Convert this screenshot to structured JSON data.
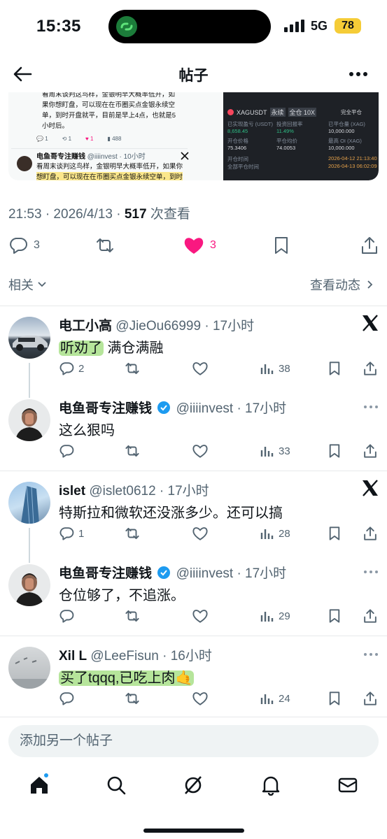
{
  "status": {
    "time": "15:35",
    "network": "5G",
    "battery": "78"
  },
  "header": {
    "title": "帖子"
  },
  "media": {
    "left_text_top": [
      "看周末谈判这鸟样，金银明早大概率低开，如",
      "果你想盯盘，可以现在在币圈买点金银永续空",
      "单，到时开盘就平，目前是早上4点，也就是5",
      "小时后。"
    ],
    "left_stats": [
      "1",
      "1",
      "1",
      "488"
    ],
    "quote_name": "电鱼哥专注赚钱",
    "quote_handle": "@iiiinvest · 10小时",
    "quote_text": [
      "看周末谈判这鸟样，金银明早大概率低开，如果你",
      "想盯盘，可以现在在币圈买点金银永续空单，到时"
    ],
    "right_symbol": "XAGUSDT",
    "right_tags": [
      "永续",
      "全仓 10X"
    ],
    "right_margin_label": "完全平仓",
    "right_rows": [
      [
        "已实现盈亏 (USDT)",
        "投资回报率",
        "已平仓量 (XAG)"
      ],
      [
        "8,658.45",
        "11.49%",
        "10,000.000"
      ],
      [
        "开仓价格",
        "平仓均价",
        "最高 OI (XAG)"
      ],
      [
        "75.3406",
        "74.0053",
        "10,000.000"
      ],
      [
        "开仓时间",
        "",
        "2026-04-12 21:13:40"
      ],
      [
        "全部平仓时间",
        "",
        "2026-04-13 06:02:09"
      ]
    ]
  },
  "post_meta": {
    "time": "21:53 · 2026/4/13 · ",
    "views": "517",
    "views_label": " 次查看"
  },
  "post_actions": {
    "replies": "3",
    "likes": "3"
  },
  "related": {
    "label": "相关",
    "activity": "查看动态"
  },
  "replies": [
    {
      "name": "电工小高",
      "handle": "@JieOu66999 · 17小时",
      "highlight": "听劝了",
      "text": " 满仓满融",
      "reply_count": "2",
      "retweets": "",
      "likes": "",
      "views": "38",
      "source_icon": "x-logo"
    },
    {
      "name": "电鱼哥专注赚钱",
      "handle": "@iiiinvest · 17小时",
      "highlight": "",
      "text": "这么狠吗",
      "reply_count": "",
      "retweets": "",
      "likes": "",
      "views": "33",
      "source_icon": "more-dots"
    },
    {
      "name": "islet",
      "handle": "@islet0612 · 17小时",
      "highlight": "",
      "text": "特斯拉和微软还没涨多少。还可以搞",
      "reply_count": "1",
      "retweets": "",
      "likes": "",
      "views": "28",
      "source_icon": "x-logo"
    },
    {
      "name": "电鱼哥专注赚钱",
      "handle": "@iiiinvest · 17小时",
      "highlight": "",
      "text": "仓位够了，不追涨。",
      "reply_count": "",
      "retweets": "",
      "likes": "",
      "views": "29",
      "source_icon": "more-dots"
    },
    {
      "name": "Xil L",
      "handle": "@LeeFisun · 16小时",
      "highlight": "买了tqqq,已吃上肉🤙",
      "text": "",
      "reply_count": "",
      "retweets": "",
      "likes": "",
      "views": "24",
      "source_icon": "more-dots"
    }
  ],
  "compose": {
    "placeholder": "添加另一个帖子"
  },
  "tabs": [
    "home-icon",
    "search-icon",
    "grok-icon",
    "bell-icon",
    "mail-icon"
  ],
  "colors": {
    "like": "#f91880",
    "verified": "#1d9bf0",
    "highlight": "#b6e59b",
    "battery": "#f5cc37"
  }
}
